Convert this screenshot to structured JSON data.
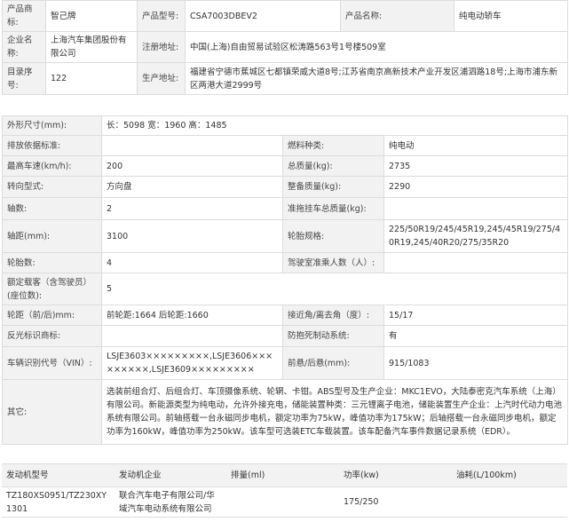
{
  "header": {
    "name_label": "产品商标:",
    "name_value": "智己牌",
    "model_label": "产品型号:",
    "model_value": "CSA7003DBEV2",
    "pname_label": "产品名称:",
    "pname_value": "纯电动轿车",
    "company_label": "企业名称:",
    "company_value": "上海汽车集团股份有限公司",
    "reg_label": "注册地址:",
    "reg_value": "中国(上海)自由贸易试验区松涛路563号1号楼509室",
    "catalog_label": "目录序号:",
    "catalog_value": "122",
    "prod_label": "生产地址:",
    "prod_value": "福建省宁德市蕉城区七都镇荣威大道8号;江苏省南京高新技术产业开发区浦泗路18号;上海市浦东新区两港大道2999号"
  },
  "specs": {
    "rows": [
      {
        "l1": "外形尺寸(mm):",
        "v1": "长：5098 宽：1960 高：1485"
      },
      {
        "l1": "排放依据标准:",
        "v1": "",
        "l2": "燃料种类:",
        "v2": "纯电动"
      },
      {
        "l1": "最高车速(km/h):",
        "v1": "200",
        "l2": "总质量(kg):",
        "v2": "2735"
      },
      {
        "l1": "转向型式:",
        "v1": "方向盘",
        "l2": "整备质量(kg):",
        "v2": "2290"
      },
      {
        "l1": "轴数:",
        "v1": "2",
        "l2": "准拖挂车总质量(kg):",
        "v2": ""
      },
      {
        "l1": "轴距(mm):",
        "v1": "3100",
        "l2": "轮胎规格:",
        "v2": "225/50R19/245/45R19,245/45R19/275/40R19,245/40R20/275/35R20"
      },
      {
        "l1": "轮胎数:",
        "v1": "4",
        "l2": "驾驶室准乘人数（人）:",
        "v2": ""
      },
      {
        "l1": "额定载客（含驾驶员）(座位数):",
        "v1": "5"
      },
      {
        "l1": "轮距（前/后)mm:",
        "v1": "前轮距:1664 后轮距:1660",
        "l2": "接近角/离去角（度）:",
        "v2": "15/17"
      },
      {
        "l1": "反光标识商标:",
        "v1": "",
        "l2": "防抱死制动系统:",
        "v2": "有"
      },
      {
        "l1": "车辆识别代号（VIN）:",
        "v1": "LSJE3603×××××××××,LSJE3606×××××××××,LSJE3609×××××××××",
        "l2": "前悬/后悬(mm):",
        "v2": "915/1083"
      },
      {
        "l1": "其它:",
        "v1": "选装前组合灯、后组合灯、车顶摄像系统、轮辋、卡钳。ABS型号及生产企业：MKC1EVO，大陆泰密克汽车系统（上海）有限公司。新能源类型为纯电动，允许外接充电，储能装置种类：三元锂离子电池，储能装置生产企业：上汽时代动力电池系统有限公司。前轴搭载一台永磁同步电机，额定功率为75kW，峰值功率为175kW；后轴搭载一台永磁同步电机，额定功率为160kW，峰值功率为250kW。该车型可选装ETC车载装置。该车配备汽车事件数据记录系统（EDR）。"
      }
    ]
  },
  "engine": {
    "headers": [
      "发动机型号",
      "发动机企业",
      "排量(ml)",
      "功率(kw)",
      "油耗(L/100km)"
    ],
    "row": [
      "TZ180XS0951/TZ230XY1301",
      "联合汽车电子有限公司/华域汽车电动系统有限公司",
      "",
      "175/250",
      ""
    ]
  }
}
